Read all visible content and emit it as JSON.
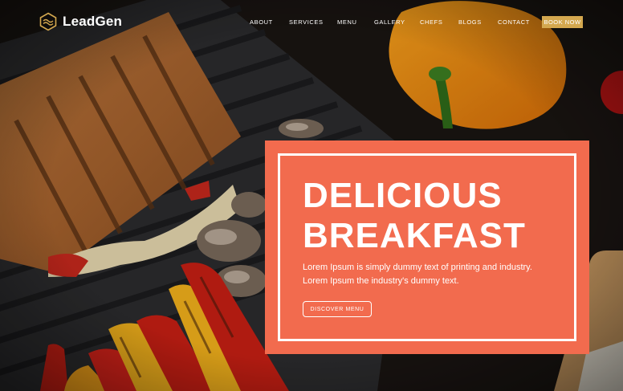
{
  "brand": {
    "name": "LeadGen",
    "logo_icon": "hexagon-logo-icon"
  },
  "nav": {
    "items": [
      "ABOUT",
      "SERVICES",
      "MENU",
      "GALLERY",
      "CHEFS",
      "BLOGS",
      "CONTACT"
    ],
    "cta_label": "BOOK NOW"
  },
  "hero": {
    "headline_line1": "DELICIOUS",
    "headline_line2": "BREAKFAST",
    "description": "Lorem Ipsum is simply dummy text of printing and industry. Lorem Ipsum the industry's dummy text.",
    "button_label": "DISCOVER MENU"
  },
  "colors": {
    "accent": "#f26b4e",
    "book_button": "#d4a84f",
    "text": "#ffffff",
    "background": "#161616"
  }
}
